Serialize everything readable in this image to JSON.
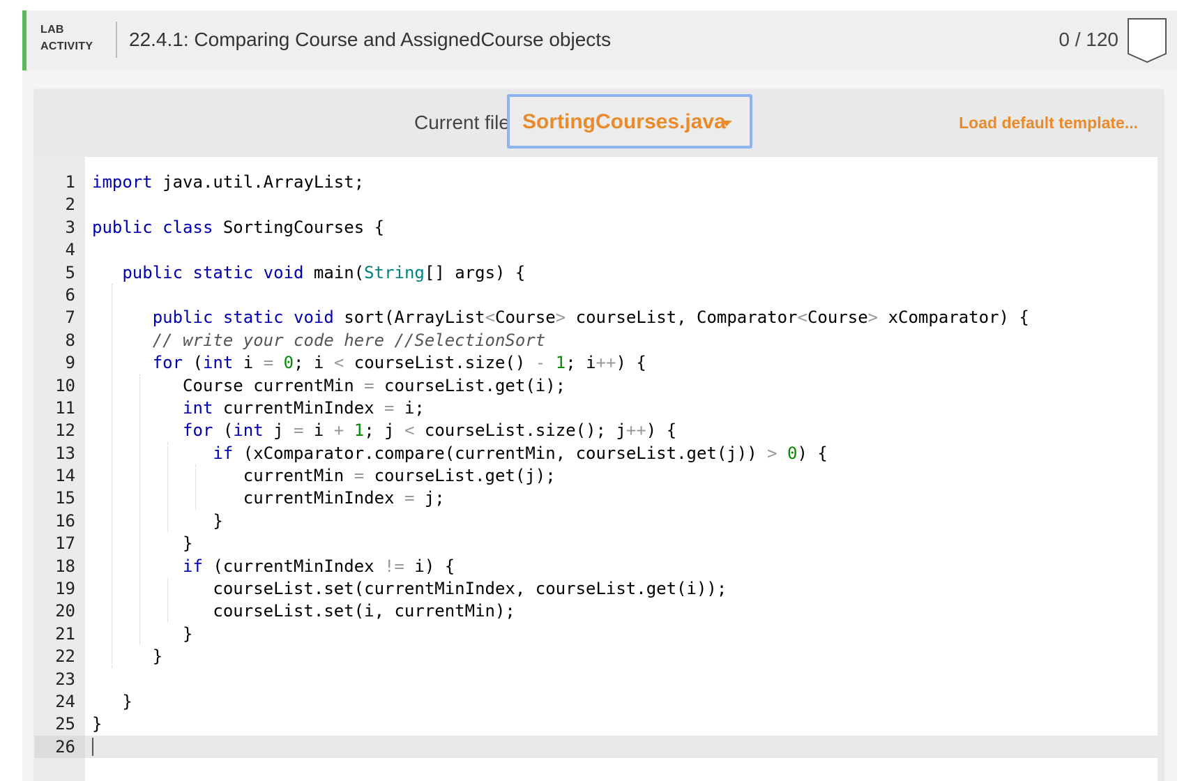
{
  "header": {
    "lab_tag_line1": "LAB",
    "lab_tag_line2": "ACTIVITY",
    "title": "22.4.1: Comparing Course and AssignedCourse objects",
    "score": "0 / 120",
    "accent_color": "#5cb85c"
  },
  "toolbar": {
    "current_file_label": "Current file:",
    "current_file": "SortingCourses.java",
    "load_template_label": "Load default template...",
    "accent_color": "#e98b2a"
  },
  "editor": {
    "cursor_line": 26,
    "lines": [
      {
        "n": "1",
        "text": "import java.util.ArrayList;"
      },
      {
        "n": "2",
        "text": ""
      },
      {
        "n": "3",
        "text": "public class SortingCourses {"
      },
      {
        "n": "4",
        "text": ""
      },
      {
        "n": "5",
        "text": "   public static void main(String[] args) {"
      },
      {
        "n": "6",
        "text": ""
      },
      {
        "n": "7",
        "text": "      public static void sort(ArrayList<Course> courseList, Comparator<Course> xComparator) {"
      },
      {
        "n": "8",
        "text": "      // write your code here //SelectionSort"
      },
      {
        "n": "9",
        "text": "      for (int i = 0; i < courseList.size() - 1; i++) {"
      },
      {
        "n": "10",
        "text": "         Course currentMin = courseList.get(i);"
      },
      {
        "n": "11",
        "text": "         int currentMinIndex = i;"
      },
      {
        "n": "12",
        "text": "         for (int j = i + 1; j < courseList.size(); j++) {"
      },
      {
        "n": "13",
        "text": "            if (xComparator.compare(currentMin, courseList.get(j)) > 0) {"
      },
      {
        "n": "14",
        "text": "               currentMin = courseList.get(j);"
      },
      {
        "n": "15",
        "text": "               currentMinIndex = j;"
      },
      {
        "n": "16",
        "text": "            }"
      },
      {
        "n": "17",
        "text": "         }"
      },
      {
        "n": "18",
        "text": "         if (currentMinIndex != i) {"
      },
      {
        "n": "19",
        "text": "            courseList.set(currentMinIndex, courseList.get(i));"
      },
      {
        "n": "20",
        "text": "            courseList.set(i, currentMin);"
      },
      {
        "n": "21",
        "text": "         }"
      },
      {
        "n": "22",
        "text": "      }"
      },
      {
        "n": "23",
        "text": ""
      },
      {
        "n": "24",
        "text": "   }"
      },
      {
        "n": "25",
        "text": "}"
      },
      {
        "n": "26",
        "text": ""
      }
    ]
  }
}
